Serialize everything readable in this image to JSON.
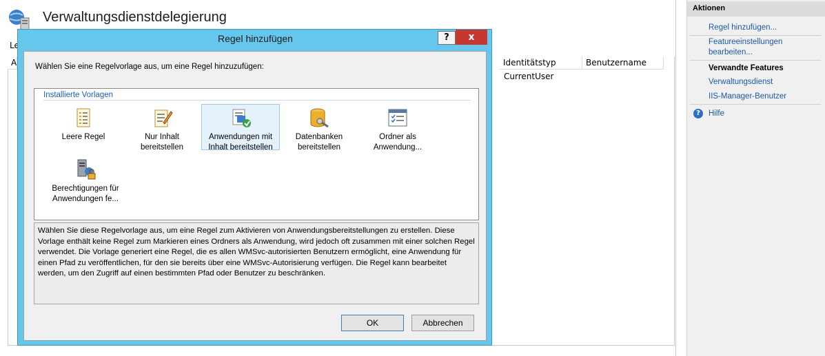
{
  "page": {
    "title": "Verwaltungsdienstdelegierung",
    "truncated_label": "Le",
    "truncated_col": "A",
    "columns": [
      "Identitätstyp",
      "Benutzername"
    ],
    "row": {
      "identity_type": "CurrentUser"
    }
  },
  "actions": {
    "header": "Aktionen",
    "add_rule": "Regel hinzufügen...",
    "feature_settings_line1": "Featureeinstellungen",
    "feature_settings_line2": "bearbeiten...",
    "related_header": "Verwandte Features",
    "admin_service": "Verwaltungsdienst",
    "iis_users": "IIS-Manager-Benutzer",
    "help": "Hilfe",
    "help_icon": "?"
  },
  "dialog": {
    "title": "Regel hinzufügen",
    "help_button": "?",
    "close_button": "x",
    "prompt": "Wählen Sie eine Regelvorlage aus, um eine Regel hinzuzufügen:",
    "group_label": "Installierte Vorlagen",
    "templates": [
      {
        "line1": "Leere Regel",
        "line2": "",
        "icon": "blank-rule-icon",
        "selected": false
      },
      {
        "line1": "Nur Inhalt",
        "line2": "bereitstellen",
        "icon": "content-only-icon",
        "selected": false
      },
      {
        "line1": "Anwendungen mit",
        "line2": "Inhalt bereitstellen",
        "icon": "apps-content-icon",
        "selected": true
      },
      {
        "line1": "Datenbanken",
        "line2": "bereitstellen",
        "icon": "database-icon",
        "selected": false
      },
      {
        "line1": "Ordner als",
        "line2": "Anwendung...",
        "icon": "folder-app-icon",
        "selected": false
      },
      {
        "line1": "Berechtigungen für",
        "line2": "Anwendungen fe...",
        "icon": "permissions-icon",
        "selected": false
      }
    ],
    "description": "Wählen Sie diese Regelvorlage aus, um eine Regel zum Aktivieren von Anwendungsbereitstellungen zu erstellen. Diese Vorlage enthält keine Regel zum Markieren eines Ordners als Anwendung, wird jedoch oft zusammen mit einer solchen Regel verwendet. Die Vorlage generiert eine Regel, die es allen WMSvc-autorisierten Benutzern ermöglicht, eine Anwendung für einen Pfad zu veröffentlichen, für den sie bereits über eine WMSvc-Autorisierung verfügen. Die Regel kann bearbeitet werden, um den Zugriff auf einen bestimmten Pfad oder Benutzer zu beschränken.",
    "ok": "OK",
    "cancel": "Abbrechen"
  }
}
